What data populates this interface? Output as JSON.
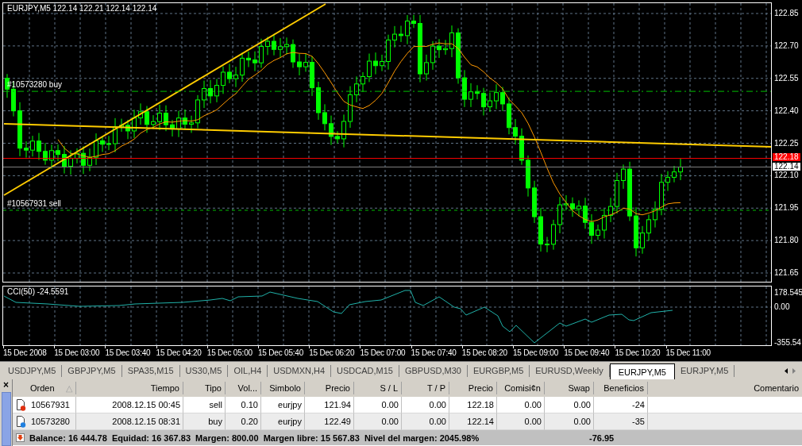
{
  "chart": {
    "title": "EURJPY,M5",
    "ohlc": "122.14 122.21 122.14 122.14",
    "price_ticks": [
      "122.85",
      "122.70",
      "122.55",
      "122.40",
      "122.25",
      "122.10",
      "121.95",
      "121.80",
      "121.65"
    ],
    "order_lines": [
      {
        "label": "#10573280 buy",
        "kind": "buy"
      },
      {
        "label": "#10567931 sell",
        "kind": "sell"
      }
    ],
    "ask_label": "122.18",
    "bid_label": "122.14",
    "indicator": {
      "label": "CCI(50) -24.5591",
      "ticks": [
        "178.545",
        "0.00",
        "-355.54"
      ]
    },
    "time_labels": [
      "15 Dec 2008",
      "15 Dec 03:00",
      "15 Dec 03:40",
      "15 Dec 04:20",
      "15 Dec 05:00",
      "15 Dec 05:40",
      "15 Dec 06:20",
      "15 Dec 07:00",
      "15 Dec 07:40",
      "15 Dec 08:20",
      "15 Dec 09:00",
      "15 Dec 09:40",
      "15 Dec 10:20",
      "15 Dec 11:00"
    ]
  },
  "chart_tabs": [
    {
      "label": "USDJPY,M5",
      "selected": false
    },
    {
      "label": "GBPJPY,M5",
      "selected": false
    },
    {
      "label": "SPA35,M15",
      "selected": false
    },
    {
      "label": "US30,M5",
      "selected": false
    },
    {
      "label": "OIL,H4",
      "selected": false
    },
    {
      "label": "USDMXN,H4",
      "selected": false
    },
    {
      "label": "USDCAD,M15",
      "selected": false
    },
    {
      "label": "GBPUSD,M30",
      "selected": false
    },
    {
      "label": "EURGBP,M5",
      "selected": false
    },
    {
      "label": "EURUSD,Weekly",
      "selected": false
    },
    {
      "label": "EURJPY,M5",
      "selected": true
    },
    {
      "label": "EURJPY,M5",
      "selected": false
    }
  ],
  "terminal": {
    "close": "×",
    "columns": [
      {
        "label": "Orden",
        "sort_indicator": "△"
      },
      {
        "label": "Tiempo"
      },
      {
        "label": "Tipo"
      },
      {
        "label": "Vol..."
      },
      {
        "label": "Simbolo"
      },
      {
        "label": "Precio"
      },
      {
        "label": "S / L"
      },
      {
        "label": "T / P"
      },
      {
        "label": "Precio"
      },
      {
        "label": "Comisi¢n"
      },
      {
        "label": "Swap"
      },
      {
        "label": "Beneficios"
      },
      {
        "label": "Comentario"
      }
    ],
    "rows": [
      {
        "kind": "sell",
        "cells": [
          "10567931",
          "2008.12.15 00:45",
          "sell",
          "0.10",
          "eurjpy",
          "121.94",
          "0.00",
          "0.00",
          "122.18",
          "0.00",
          "0.00",
          "-24"
        ]
      },
      {
        "kind": "buy",
        "cells": [
          "10573280",
          "2008.12.15 08:31",
          "buy",
          "0.20",
          "eurjpy",
          "122.49",
          "0.00",
          "0.00",
          "122.14",
          "0.00",
          "0.00",
          "-35"
        ]
      }
    ],
    "summary": "Balance: 16 444.78  Equidad: 16 367.83  Margen: 800.00  Margen libre: 15 567.83  Nivel del margen: 2045.98%",
    "total_profit": "-76.95"
  }
}
